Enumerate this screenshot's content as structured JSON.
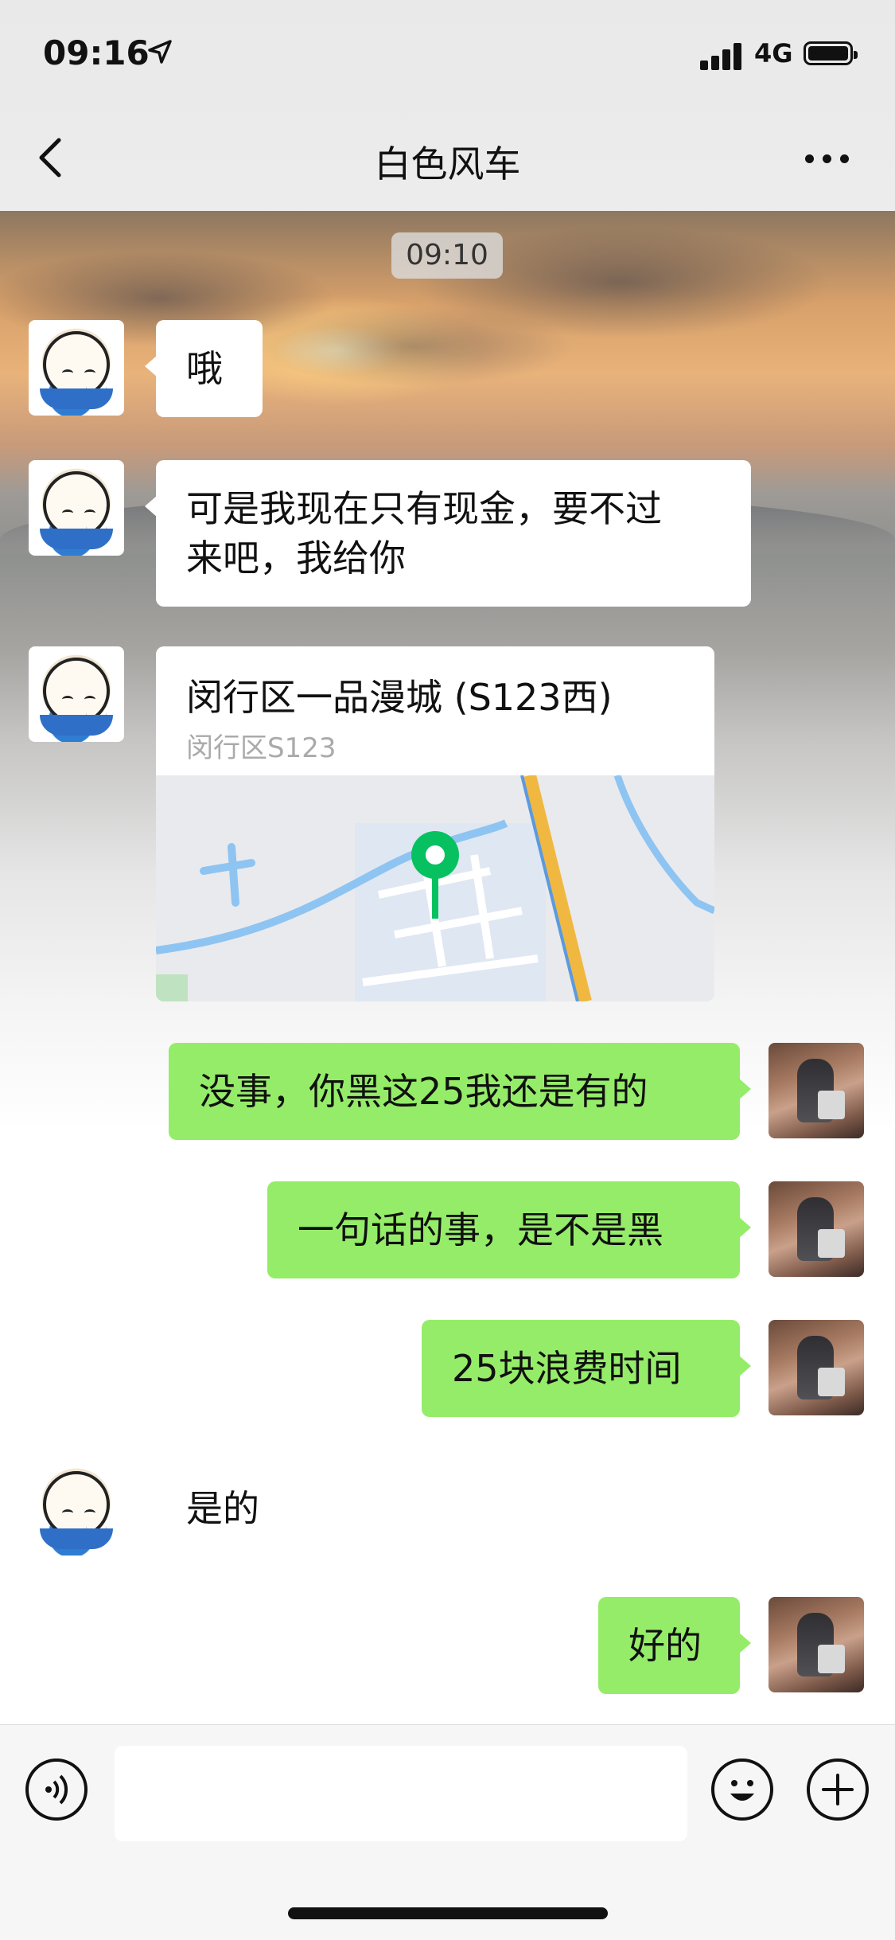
{
  "status": {
    "time": "09:16",
    "network": "4G"
  },
  "header": {
    "title": "白色风车"
  },
  "chat": {
    "timestamp": "09:10",
    "messages": [
      {
        "side": "left",
        "text": "哦"
      },
      {
        "side": "left",
        "text_line1": "可是我现在只有现金，要不过",
        "text_line2": "来吧，我给你"
      },
      {
        "side": "left",
        "type": "location",
        "title": "闵行区一品漫城 (S123西)",
        "subtitle": "闵行区S123"
      },
      {
        "side": "right",
        "text": "没事，你黑这25我还是有的"
      },
      {
        "side": "right",
        "text": "一句话的事，是不是黑"
      },
      {
        "side": "right",
        "text": "25块浪费时间"
      },
      {
        "side": "left",
        "text": "是的"
      },
      {
        "side": "right",
        "text": "好的"
      }
    ]
  },
  "icons": {
    "back": "chevron-left-icon",
    "more": "more-dots-icon",
    "location_pin": "map-pin-icon",
    "voice": "voice-icon",
    "emoji": "emoji-icon",
    "plus": "plus-icon"
  },
  "colors": {
    "outgoing_bubble": "#95ec69",
    "incoming_bubble": "#ffffff",
    "pin": "#07c160"
  }
}
